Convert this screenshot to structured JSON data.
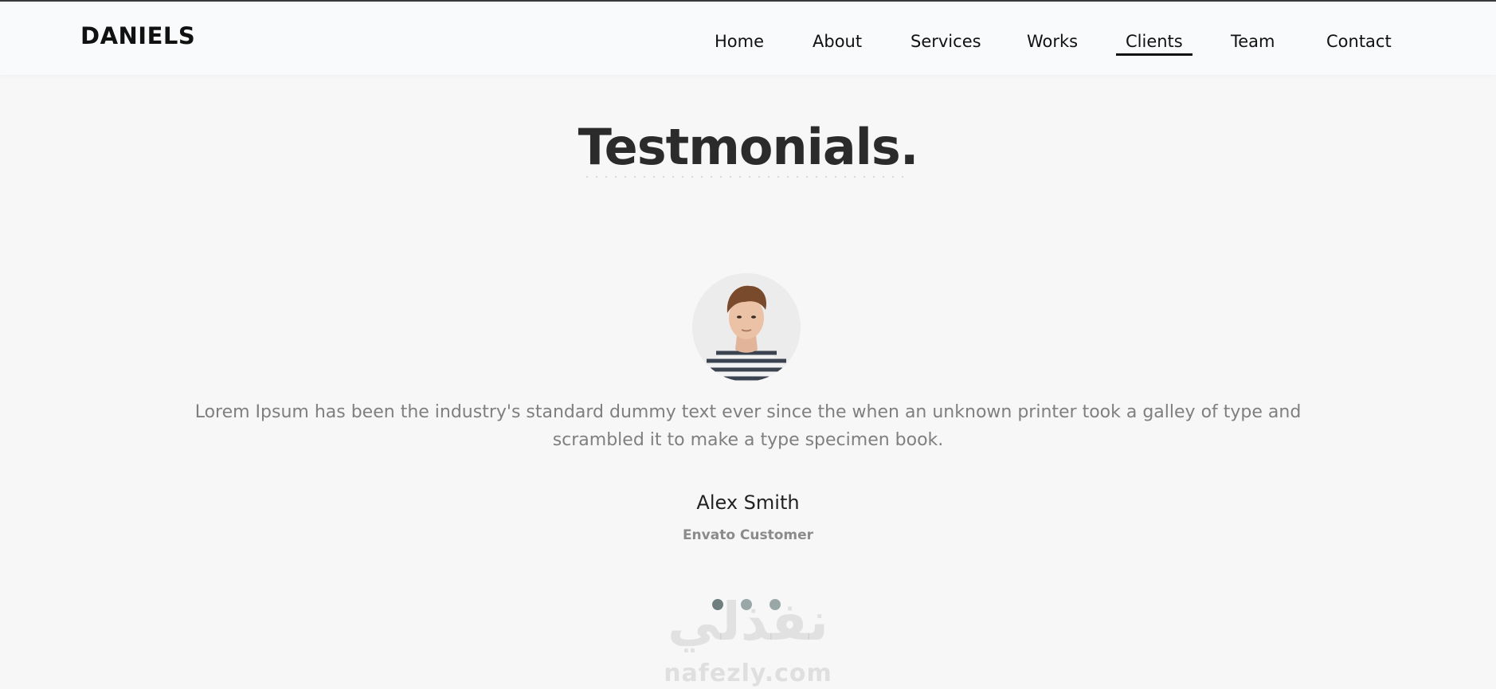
{
  "header": {
    "logo": "DANIELS",
    "nav": [
      {
        "label": "Home"
      },
      {
        "label": "About"
      },
      {
        "label": "Services"
      },
      {
        "label": "Works"
      },
      {
        "label": "Clients",
        "active": true
      },
      {
        "label": "Team"
      },
      {
        "label": "Contact"
      }
    ]
  },
  "section": {
    "title": "Testmonials."
  },
  "testimonial": {
    "quote": "Lorem Ipsum has been the industry's standard dummy text ever since the when an unknown printer took a galley of type and scrambled it to make a type specimen book.",
    "name": "Alex Smith",
    "role": "Envato Customer",
    "avatar_icon": "person-photo"
  },
  "slider": {
    "total": 3,
    "active_index": 0
  },
  "watermark": {
    "arabic": "نفذلي",
    "latin": "nafezly.com"
  },
  "colors": {
    "background": "#f7f7f7",
    "header_bg": "#f9fafb",
    "title": "#2b2b2b",
    "quote": "#7f7f7f",
    "role": "#8b8b8b",
    "dot": "#9aa7a7"
  }
}
